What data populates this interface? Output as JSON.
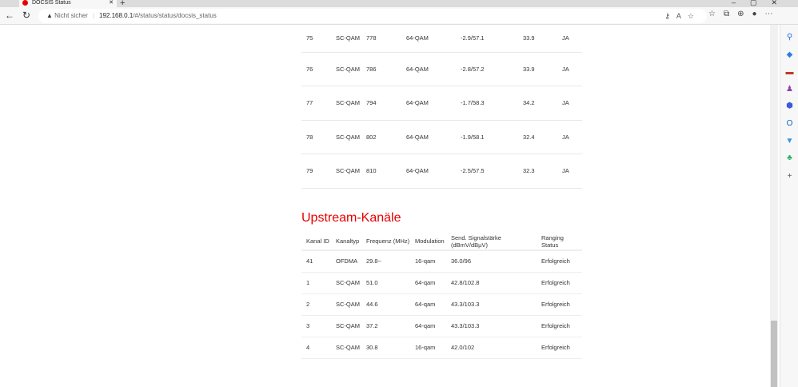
{
  "browser": {
    "tab_title": "DOCSIS Status",
    "security": "Nicht sicher",
    "url_host": "192.168.0.1",
    "url_path": "/#/status/status/docsis_status"
  },
  "downstream": {
    "rows": [
      {
        "id": "75",
        "type": "SC-QAM",
        "freq": "778",
        "mod": "64-QAM",
        "power": "-2.9/57.1",
        "snr": "33.9",
        "locked": "JA"
      },
      {
        "id": "76",
        "type": "SC-QAM",
        "freq": "786",
        "mod": "64-QAM",
        "power": "-2.8/57.2",
        "snr": "33.9",
        "locked": "JA"
      },
      {
        "id": "77",
        "type": "SC-QAM",
        "freq": "794",
        "mod": "64-QAM",
        "power": "-1.7/58.3",
        "snr": "34.2",
        "locked": "JA"
      },
      {
        "id": "78",
        "type": "SC-QAM",
        "freq": "802",
        "mod": "64-QAM",
        "power": "-1.9/58.1",
        "snr": "32.4",
        "locked": "JA"
      },
      {
        "id": "79",
        "type": "SC-QAM",
        "freq": "810",
        "mod": "64-QAM",
        "power": "-2.5/57.5",
        "snr": "32.3",
        "locked": "JA"
      }
    ]
  },
  "upstream": {
    "title": "Upstream-Kanäle",
    "headers": [
      "Kanal ID",
      "Kanaltyp",
      "Frequenz (MHz)",
      "Modulation",
      "Send. Signalstärke (dBmV/dBµV)",
      "Ranging Status"
    ],
    "rows": [
      [
        "41",
        "OFDMA",
        "29.8~",
        "16-qam",
        "36.0/96",
        "Erfolgreich"
      ],
      [
        "1",
        "SC-QAM",
        "51.0",
        "64-qam",
        "42.8/102.8",
        "Erfolgreich"
      ],
      [
        "2",
        "SC-QAM",
        "44.6",
        "64-qam",
        "43.3/103.3",
        "Erfolgreich"
      ],
      [
        "3",
        "SC-QAM",
        "37.2",
        "64-qam",
        "43.3/103.3",
        "Erfolgreich"
      ],
      [
        "4",
        "SC-QAM",
        "30.8",
        "16-qam",
        "42.0/102",
        "Erfolgreich"
      ]
    ]
  },
  "colors": {
    "accent": "#e60000"
  }
}
